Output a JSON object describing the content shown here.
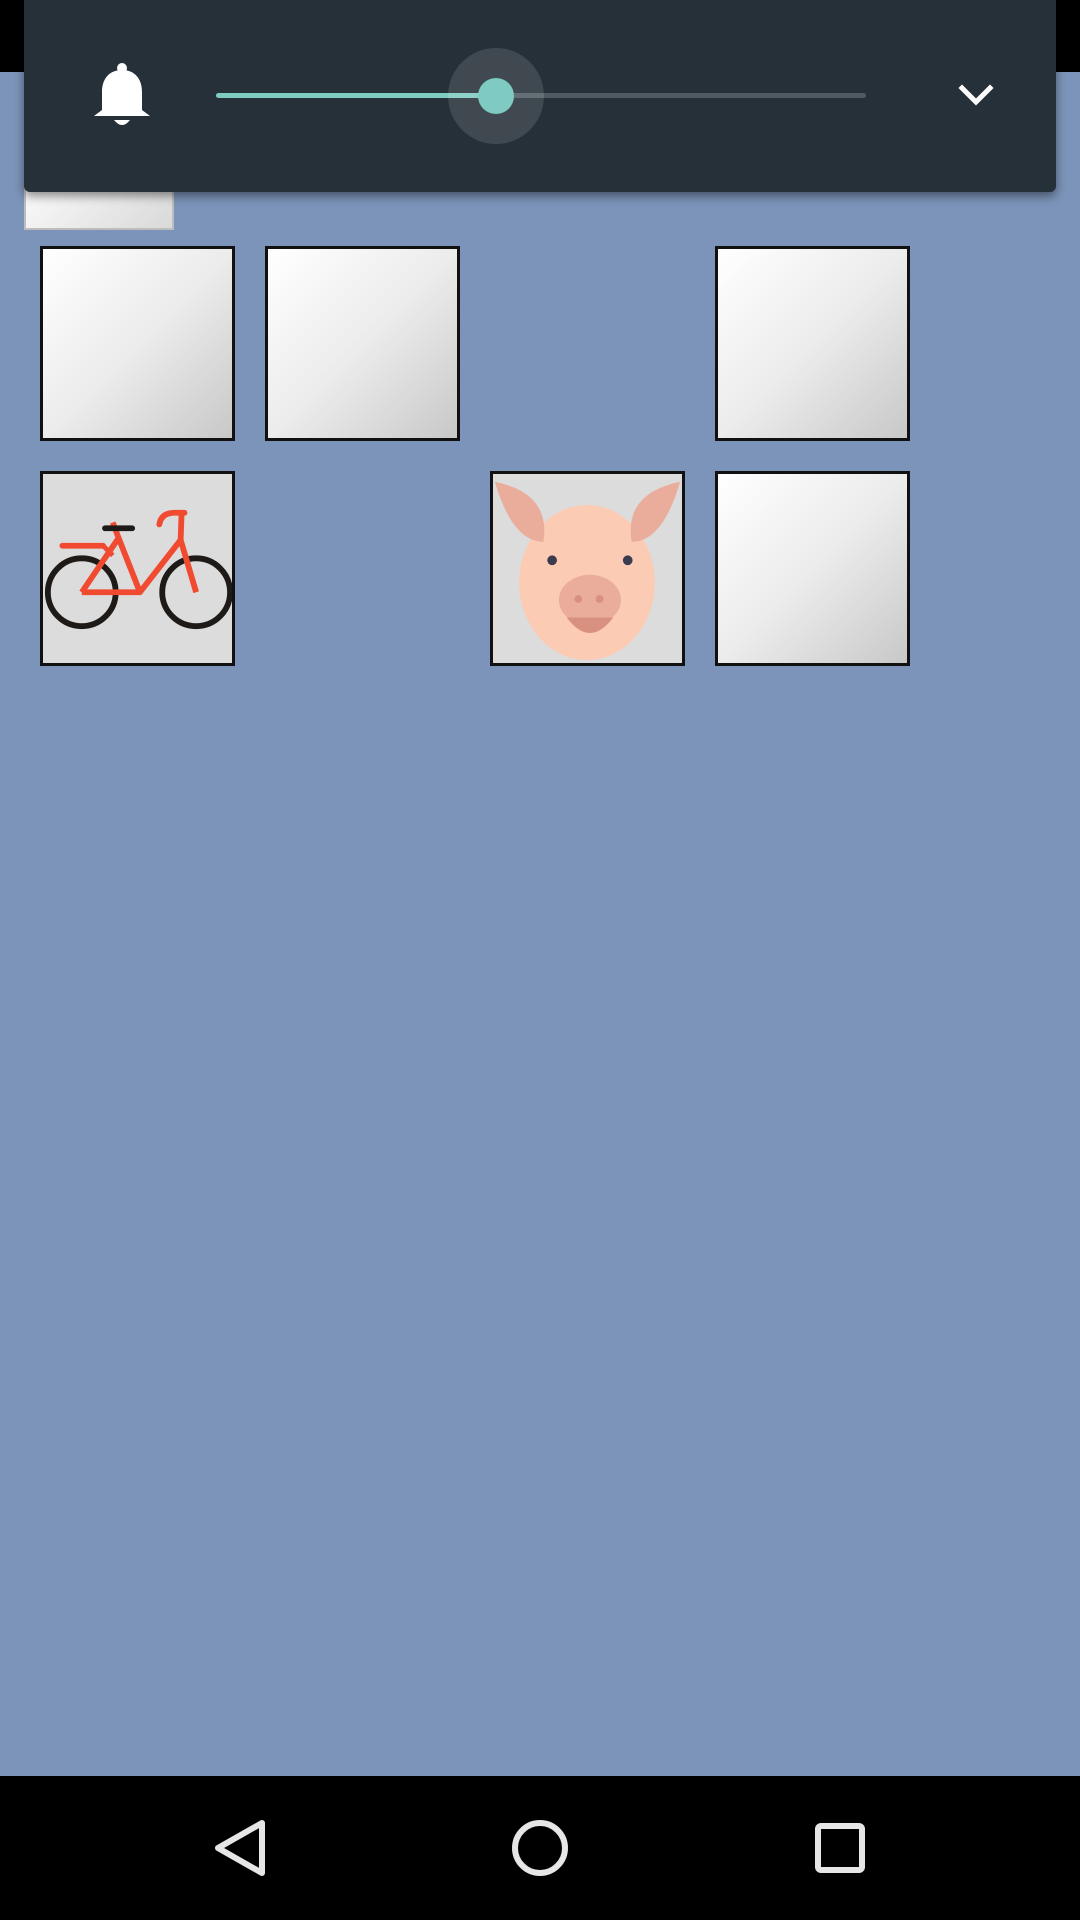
{
  "volume": {
    "level_fraction": 0.43,
    "icon": "bell-icon",
    "expand_icon": "chevron-down-icon",
    "accent_color": "#7fcbc4",
    "panel_color": "#263038"
  },
  "board": {
    "background_color": "#7c94b9",
    "tiles": [
      {
        "row": 1,
        "col": 1,
        "state": "face-down"
      },
      {
        "row": 1,
        "col": 2,
        "state": "face-down"
      },
      {
        "row": 1,
        "col": 3,
        "state": "matched-empty"
      },
      {
        "row": 1,
        "col": 4,
        "state": "face-down"
      },
      {
        "row": 2,
        "col": 1,
        "state": "face-up",
        "image": "bicycle-icon"
      },
      {
        "row": 2,
        "col": 2,
        "state": "matched-empty"
      },
      {
        "row": 2,
        "col": 3,
        "state": "face-up",
        "image": "pig-icon"
      },
      {
        "row": 2,
        "col": 4,
        "state": "face-down"
      }
    ]
  },
  "navigation": {
    "back_icon": "back-triangle-icon",
    "home_icon": "home-circle-icon",
    "recents_icon": "recents-square-icon"
  }
}
